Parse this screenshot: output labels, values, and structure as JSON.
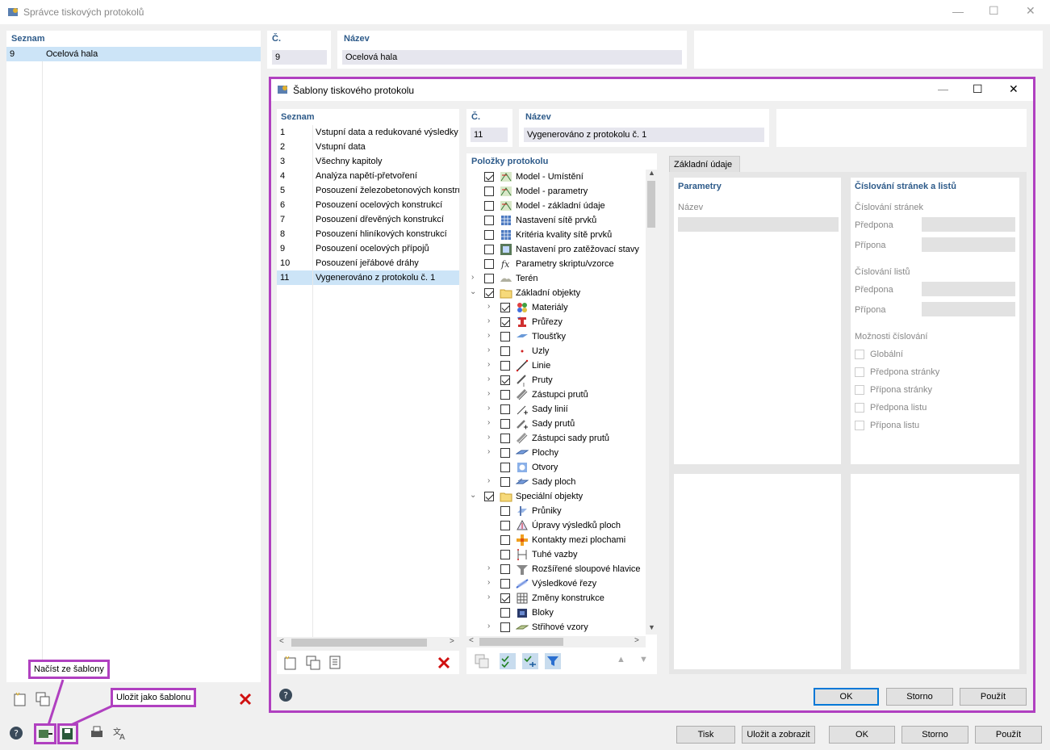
{
  "outer": {
    "title": "Správce tiskových protokolů",
    "list_header": "Seznam",
    "list": [
      {
        "num": "9",
        "name": "Ocelová hala"
      }
    ],
    "no_label": "Č.",
    "no_value": "9",
    "name_label": "Název",
    "name_value": "Ocelová hala",
    "callout_load": "Načíst ze šablony",
    "callout_save": "Uložit jako šablonu",
    "buttons": {
      "print": "Tisk",
      "save_show": "Uložit a zobrazit",
      "ok": "OK",
      "cancel": "Storno",
      "apply": "Použít"
    }
  },
  "dialog": {
    "title": "Šablony tiskového protokolu",
    "list_header": "Seznam",
    "list": [
      {
        "num": "1",
        "name": "Vstupní data a redukované výsledky"
      },
      {
        "num": "2",
        "name": "Vstupní data"
      },
      {
        "num": "3",
        "name": "Všechny kapitoly"
      },
      {
        "num": "4",
        "name": "Analýza napětí-přetvoření"
      },
      {
        "num": "5",
        "name": "Posouzení železobetonových konstrukcí"
      },
      {
        "num": "6",
        "name": "Posouzení ocelových konstrukcí"
      },
      {
        "num": "7",
        "name": "Posouzení dřevěných konstrukcí"
      },
      {
        "num": "8",
        "name": "Posouzení hliníkových konstrukcí"
      },
      {
        "num": "9",
        "name": "Posouzení ocelových přípojů"
      },
      {
        "num": "10",
        "name": "Posouzení jeřábové dráhy"
      },
      {
        "num": "11",
        "name": "Vygenerováno z protokolu č. 1"
      }
    ],
    "no_label": "Č.",
    "no_value": "11",
    "name_label": "Název",
    "name_value": "Vygenerováno z protokolu č. 1",
    "items_header": "Položky protokolu",
    "items": [
      {
        "label": "Model - Umístění",
        "checked": true,
        "level": 0,
        "expand": false,
        "icon": "model-icon"
      },
      {
        "label": "Model - parametry",
        "checked": false,
        "level": 0,
        "expand": false,
        "icon": "model-icon"
      },
      {
        "label": "Model - základní údaje",
        "checked": false,
        "level": 0,
        "expand": false,
        "icon": "model-icon"
      },
      {
        "label": "Nastavení sítě prvků",
        "checked": false,
        "level": 0,
        "expand": false,
        "icon": "mesh-icon"
      },
      {
        "label": "Kritéria kvality sítě prvků",
        "checked": false,
        "level": 0,
        "expand": false,
        "icon": "mesh-icon"
      },
      {
        "label": "Nastavení pro zatěžovací stavy",
        "checked": false,
        "level": 0,
        "expand": false,
        "icon": "loadcase-icon"
      },
      {
        "label": "Parametry skriptu/vzorce",
        "checked": false,
        "level": 0,
        "expand": false,
        "icon": "formula-icon"
      },
      {
        "label": "Terén",
        "checked": false,
        "level": 0,
        "expand": true,
        "icon": "terrain-icon"
      },
      {
        "label": "Základní objekty",
        "checked": true,
        "level": 0,
        "expand": "open",
        "icon": "folder-icon"
      },
      {
        "label": "Materiály",
        "checked": true,
        "level": 1,
        "expand": true,
        "icon": "materials-icon"
      },
      {
        "label": "Průřezy",
        "checked": true,
        "level": 1,
        "expand": true,
        "icon": "section-icon"
      },
      {
        "label": "Tloušťky",
        "checked": false,
        "level": 1,
        "expand": true,
        "icon": "thickness-icon"
      },
      {
        "label": "Uzly",
        "checked": false,
        "level": 1,
        "expand": true,
        "icon": "node-icon"
      },
      {
        "label": "Linie",
        "checked": false,
        "level": 1,
        "expand": true,
        "icon": "line-icon"
      },
      {
        "label": "Pruty",
        "checked": true,
        "level": 1,
        "expand": true,
        "icon": "member-icon"
      },
      {
        "label": "Zástupci prutů",
        "checked": false,
        "level": 1,
        "expand": true,
        "icon": "member-rep-icon"
      },
      {
        "label": "Sady linií",
        "checked": false,
        "level": 1,
        "expand": true,
        "icon": "line-set-icon"
      },
      {
        "label": "Sady prutů",
        "checked": false,
        "level": 1,
        "expand": true,
        "icon": "member-set-icon"
      },
      {
        "label": "Zástupci sady prutů",
        "checked": false,
        "level": 1,
        "expand": true,
        "icon": "member-set-rep-icon"
      },
      {
        "label": "Plochy",
        "checked": false,
        "level": 1,
        "expand": true,
        "icon": "surface-icon"
      },
      {
        "label": "Otvory",
        "checked": false,
        "level": 1,
        "expand": false,
        "icon": "opening-icon"
      },
      {
        "label": "Sady ploch",
        "checked": false,
        "level": 1,
        "expand": true,
        "icon": "surface-set-icon"
      },
      {
        "label": "Speciální objekty",
        "checked": true,
        "level": 0,
        "expand": "open",
        "icon": "folder-icon"
      },
      {
        "label": "Průniky",
        "checked": false,
        "level": 1,
        "expand": false,
        "icon": "intersection-icon"
      },
      {
        "label": "Úpravy výsledků ploch",
        "checked": false,
        "level": 1,
        "expand": false,
        "icon": "result-smooth-icon"
      },
      {
        "label": "Kontakty mezi plochami",
        "checked": false,
        "level": 1,
        "expand": false,
        "icon": "contact-icon"
      },
      {
        "label": "Tuhé vazby",
        "checked": false,
        "level": 1,
        "expand": false,
        "icon": "rigid-link-icon"
      },
      {
        "label": "Rozšířené sloupové hlavice",
        "checked": false,
        "level": 1,
        "expand": true,
        "icon": "column-head-icon"
      },
      {
        "label": "Výsledkové řezy",
        "checked": false,
        "level": 1,
        "expand": true,
        "icon": "result-section-icon"
      },
      {
        "label": "Změny konstrukce",
        "checked": true,
        "level": 1,
        "expand": true,
        "icon": "modification-icon"
      },
      {
        "label": "Bloky",
        "checked": false,
        "level": 1,
        "expand": false,
        "icon": "block-icon"
      },
      {
        "label": "Střihové vzory",
        "checked": false,
        "level": 1,
        "expand": true,
        "icon": "pattern-icon"
      }
    ],
    "tab_label": "Základní údaje",
    "params_header": "Parametry",
    "params_name_label": "Název",
    "numbering_header": "Číslování stránek a listů",
    "page_numbering": "Číslování stránek",
    "prefix": "Předpona",
    "suffix": "Přípona",
    "sheet_numbering": "Číslování listů",
    "numbering_options": "Možnosti číslování",
    "options": [
      "Globální",
      "Předpona stránky",
      "Přípona stránky",
      "Předpona listu",
      "Přípona listu"
    ],
    "buttons": {
      "ok": "OK",
      "cancel": "Storno",
      "apply": "Použít"
    }
  },
  "colors": {
    "highlight": "#b040c0",
    "selection": "#cce4f7",
    "header": "#2e5b8a"
  }
}
